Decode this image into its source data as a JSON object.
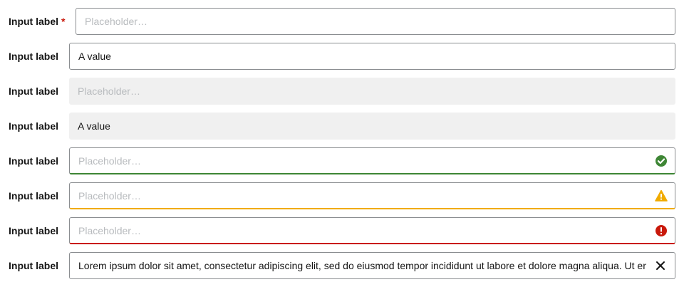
{
  "rows": [
    {
      "label": "Input label",
      "required_mark": "*",
      "placeholder": "Placeholder…"
    },
    {
      "label": "Input label",
      "value": "A value"
    },
    {
      "label": "Input label",
      "placeholder": "Placeholder…"
    },
    {
      "label": "Input label",
      "value": "A value"
    },
    {
      "label": "Input label",
      "placeholder": "Placeholder…",
      "status": "success"
    },
    {
      "label": "Input label",
      "placeholder": "Placeholder…",
      "status": "warning"
    },
    {
      "label": "Input label",
      "placeholder": "Placeholder…",
      "status": "error"
    },
    {
      "label": "Input label",
      "value": "Lorem ipsum dolor sit amet, consectetur adipiscing elit, sed do eiusmod tempor incididunt ut labore et dolore magna aliqua. Ut enim ad minim veniam"
    }
  ],
  "colors": {
    "success": "#3e8635",
    "warning": "#f0ab00",
    "error": "#c9190b",
    "required": "#c9190b"
  },
  "icons": {
    "success": "check-circle-icon",
    "warning": "warning-triangle-icon",
    "error": "exclamation-circle-icon",
    "clear": "close-icon"
  }
}
